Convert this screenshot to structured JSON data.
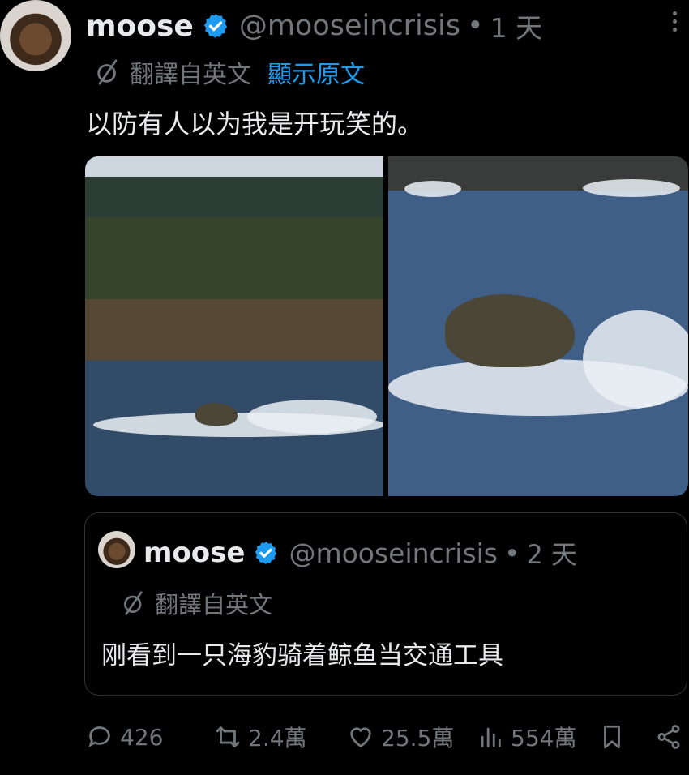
{
  "post": {
    "author_name": "moose",
    "handle": "@mooseincrisis",
    "separator": "•",
    "time": "1 天",
    "translated_label": "翻譯自英文",
    "show_original_label": "顯示原文",
    "text": "以防有人以为我是开玩笑的。"
  },
  "quote": {
    "author_name": "moose",
    "handle": "@mooseincrisis",
    "separator": "•",
    "time": "2 天",
    "translated_label": "翻譯自英文",
    "text": "刚看到一只海豹骑着鲸鱼当交通工具"
  },
  "actions": {
    "replies": "426",
    "reposts": "2.4萬",
    "likes": "25.5萬",
    "views": "554萬"
  },
  "colors": {
    "background": "#000000",
    "text": "#e7e9ea",
    "muted": "#71767b",
    "accent": "#1d9bf0"
  }
}
